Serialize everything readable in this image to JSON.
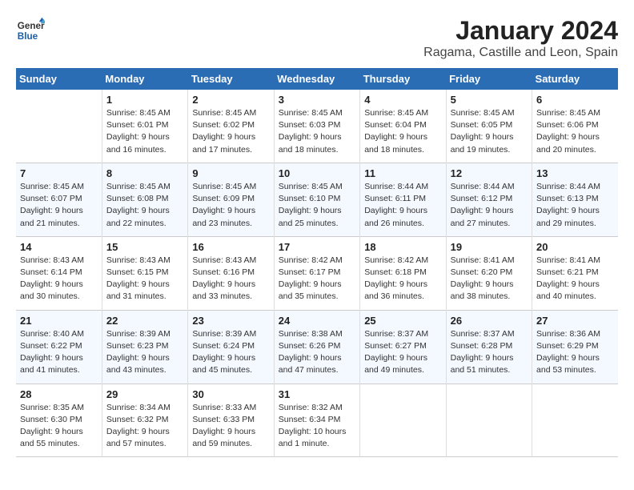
{
  "logo": {
    "general": "General",
    "blue": "Blue"
  },
  "title": "January 2024",
  "subtitle": "Ragama, Castille and Leon, Spain",
  "headers": [
    "Sunday",
    "Monday",
    "Tuesday",
    "Wednesday",
    "Thursday",
    "Friday",
    "Saturday"
  ],
  "weeks": [
    [
      {
        "num": "",
        "info": ""
      },
      {
        "num": "1",
        "info": "Sunrise: 8:45 AM\nSunset: 6:01 PM\nDaylight: 9 hours\nand 16 minutes."
      },
      {
        "num": "2",
        "info": "Sunrise: 8:45 AM\nSunset: 6:02 PM\nDaylight: 9 hours\nand 17 minutes."
      },
      {
        "num": "3",
        "info": "Sunrise: 8:45 AM\nSunset: 6:03 PM\nDaylight: 9 hours\nand 18 minutes."
      },
      {
        "num": "4",
        "info": "Sunrise: 8:45 AM\nSunset: 6:04 PM\nDaylight: 9 hours\nand 18 minutes."
      },
      {
        "num": "5",
        "info": "Sunrise: 8:45 AM\nSunset: 6:05 PM\nDaylight: 9 hours\nand 19 minutes."
      },
      {
        "num": "6",
        "info": "Sunrise: 8:45 AM\nSunset: 6:06 PM\nDaylight: 9 hours\nand 20 minutes."
      }
    ],
    [
      {
        "num": "7",
        "info": "Sunrise: 8:45 AM\nSunset: 6:07 PM\nDaylight: 9 hours\nand 21 minutes."
      },
      {
        "num": "8",
        "info": "Sunrise: 8:45 AM\nSunset: 6:08 PM\nDaylight: 9 hours\nand 22 minutes."
      },
      {
        "num": "9",
        "info": "Sunrise: 8:45 AM\nSunset: 6:09 PM\nDaylight: 9 hours\nand 23 minutes."
      },
      {
        "num": "10",
        "info": "Sunrise: 8:45 AM\nSunset: 6:10 PM\nDaylight: 9 hours\nand 25 minutes."
      },
      {
        "num": "11",
        "info": "Sunrise: 8:44 AM\nSunset: 6:11 PM\nDaylight: 9 hours\nand 26 minutes."
      },
      {
        "num": "12",
        "info": "Sunrise: 8:44 AM\nSunset: 6:12 PM\nDaylight: 9 hours\nand 27 minutes."
      },
      {
        "num": "13",
        "info": "Sunrise: 8:44 AM\nSunset: 6:13 PM\nDaylight: 9 hours\nand 29 minutes."
      }
    ],
    [
      {
        "num": "14",
        "info": "Sunrise: 8:43 AM\nSunset: 6:14 PM\nDaylight: 9 hours\nand 30 minutes."
      },
      {
        "num": "15",
        "info": "Sunrise: 8:43 AM\nSunset: 6:15 PM\nDaylight: 9 hours\nand 31 minutes."
      },
      {
        "num": "16",
        "info": "Sunrise: 8:43 AM\nSunset: 6:16 PM\nDaylight: 9 hours\nand 33 minutes."
      },
      {
        "num": "17",
        "info": "Sunrise: 8:42 AM\nSunset: 6:17 PM\nDaylight: 9 hours\nand 35 minutes."
      },
      {
        "num": "18",
        "info": "Sunrise: 8:42 AM\nSunset: 6:18 PM\nDaylight: 9 hours\nand 36 minutes."
      },
      {
        "num": "19",
        "info": "Sunrise: 8:41 AM\nSunset: 6:20 PM\nDaylight: 9 hours\nand 38 minutes."
      },
      {
        "num": "20",
        "info": "Sunrise: 8:41 AM\nSunset: 6:21 PM\nDaylight: 9 hours\nand 40 minutes."
      }
    ],
    [
      {
        "num": "21",
        "info": "Sunrise: 8:40 AM\nSunset: 6:22 PM\nDaylight: 9 hours\nand 41 minutes."
      },
      {
        "num": "22",
        "info": "Sunrise: 8:39 AM\nSunset: 6:23 PM\nDaylight: 9 hours\nand 43 minutes."
      },
      {
        "num": "23",
        "info": "Sunrise: 8:39 AM\nSunset: 6:24 PM\nDaylight: 9 hours\nand 45 minutes."
      },
      {
        "num": "24",
        "info": "Sunrise: 8:38 AM\nSunset: 6:26 PM\nDaylight: 9 hours\nand 47 minutes."
      },
      {
        "num": "25",
        "info": "Sunrise: 8:37 AM\nSunset: 6:27 PM\nDaylight: 9 hours\nand 49 minutes."
      },
      {
        "num": "26",
        "info": "Sunrise: 8:37 AM\nSunset: 6:28 PM\nDaylight: 9 hours\nand 51 minutes."
      },
      {
        "num": "27",
        "info": "Sunrise: 8:36 AM\nSunset: 6:29 PM\nDaylight: 9 hours\nand 53 minutes."
      }
    ],
    [
      {
        "num": "28",
        "info": "Sunrise: 8:35 AM\nSunset: 6:30 PM\nDaylight: 9 hours\nand 55 minutes."
      },
      {
        "num": "29",
        "info": "Sunrise: 8:34 AM\nSunset: 6:32 PM\nDaylight: 9 hours\nand 57 minutes."
      },
      {
        "num": "30",
        "info": "Sunrise: 8:33 AM\nSunset: 6:33 PM\nDaylight: 9 hours\nand 59 minutes."
      },
      {
        "num": "31",
        "info": "Sunrise: 8:32 AM\nSunset: 6:34 PM\nDaylight: 10 hours\nand 1 minute."
      },
      {
        "num": "",
        "info": ""
      },
      {
        "num": "",
        "info": ""
      },
      {
        "num": "",
        "info": ""
      }
    ]
  ]
}
